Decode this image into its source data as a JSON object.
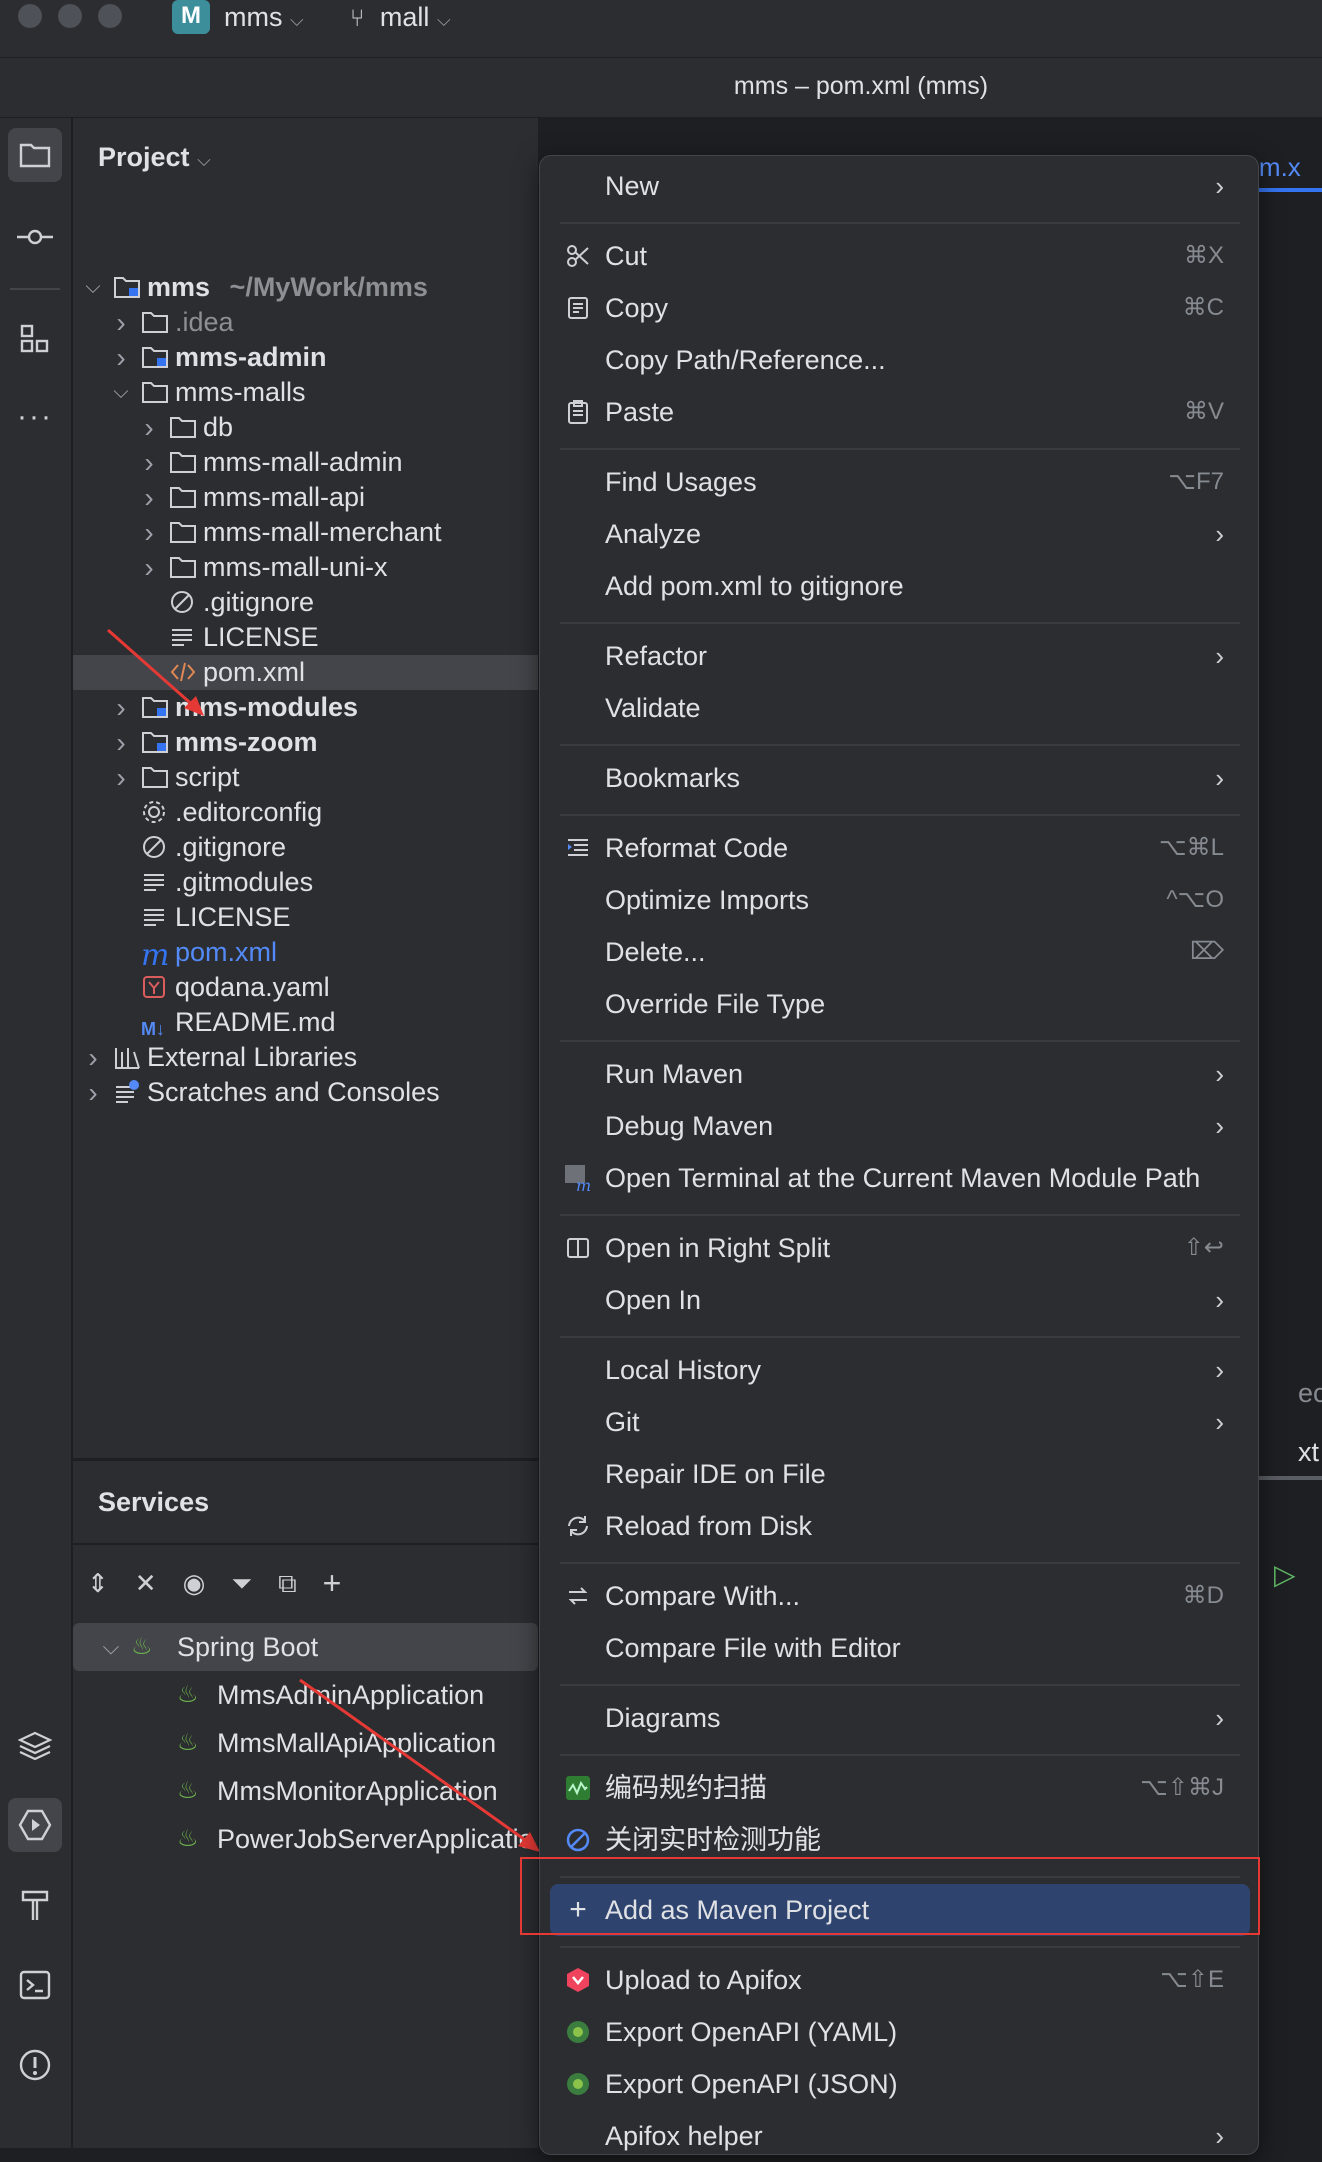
{
  "titlebar": {
    "project_badge": "M",
    "project_name": "mms",
    "branch_name": "mall",
    "window_title": "mms – pom.xml (mms)"
  },
  "editor": {
    "tab_label": "pom.x",
    "bg_text_1": "ect",
    "bg_text_2": "xt"
  },
  "project_panel": {
    "title": "Project",
    "tree": [
      {
        "label": "mms",
        "suffix": "~/MyWork/mms"
      },
      {
        "label": ".idea"
      },
      {
        "label": "mms-admin"
      },
      {
        "label": "mms-malls"
      },
      {
        "label": "db"
      },
      {
        "label": "mms-mall-admin"
      },
      {
        "label": "mms-mall-api"
      },
      {
        "label": "mms-mall-merchant"
      },
      {
        "label": "mms-mall-uni-x"
      },
      {
        "label": ".gitignore"
      },
      {
        "label": "LICENSE"
      },
      {
        "label": "pom.xml"
      },
      {
        "label": "mms-modules"
      },
      {
        "label": "mms-zoom"
      },
      {
        "label": "script"
      },
      {
        "label": ".editorconfig"
      },
      {
        "label": ".gitignore"
      },
      {
        "label": ".gitmodules"
      },
      {
        "label": "LICENSE"
      },
      {
        "label": "pom.xml"
      },
      {
        "label": "qodana.yaml"
      },
      {
        "label": "README.md"
      },
      {
        "label": "External Libraries"
      },
      {
        "label": "Scratches and Consoles"
      }
    ]
  },
  "services_panel": {
    "title": "Services",
    "group": "Spring Boot",
    "apps": [
      "MmsAdminApplication",
      "MmsMallApiApplication",
      "MmsMonitorApplication",
      "PowerJobServerApplicatio"
    ]
  },
  "context_menu": {
    "items": [
      {
        "label": "New",
        "shortcut": "",
        "submenu": true
      },
      {
        "label": "Cut",
        "shortcut": "⌘X"
      },
      {
        "label": "Copy",
        "shortcut": "⌘C"
      },
      {
        "label": "Copy Path/Reference...",
        "shortcut": ""
      },
      {
        "label": "Paste",
        "shortcut": "⌘V"
      },
      {
        "label": "Find Usages",
        "shortcut": "⌥F7"
      },
      {
        "label": "Analyze",
        "submenu": true
      },
      {
        "label": "Add pom.xml to gitignore"
      },
      {
        "label": "Refactor",
        "submenu": true
      },
      {
        "label": "Validate"
      },
      {
        "label": "Bookmarks",
        "submenu": true
      },
      {
        "label": "Reformat Code",
        "shortcut": "⌥⌘L"
      },
      {
        "label": "Optimize Imports",
        "shortcut": "^⌥O"
      },
      {
        "label": "Delete...",
        "shortcut": "⌦"
      },
      {
        "label": "Override File Type"
      },
      {
        "label": "Run Maven",
        "submenu": true
      },
      {
        "label": "Debug Maven",
        "submenu": true
      },
      {
        "label": "Open Terminal at the Current Maven Module Path"
      },
      {
        "label": "Open in Right Split",
        "shortcut": "⇧↩"
      },
      {
        "label": "Open In",
        "submenu": true
      },
      {
        "label": "Local History",
        "submenu": true
      },
      {
        "label": "Git",
        "submenu": true
      },
      {
        "label": "Repair IDE on File"
      },
      {
        "label": "Reload from Disk"
      },
      {
        "label": "Compare With...",
        "shortcut": "⌘D"
      },
      {
        "label": "Compare File with Editor"
      },
      {
        "label": "Diagrams",
        "submenu": true
      },
      {
        "label": "编码规约扫描",
        "shortcut": "⌥⇧⌘J"
      },
      {
        "label": "关闭实时检测功能"
      },
      {
        "label": "Add as Maven Project"
      },
      {
        "label": "Upload to Apifox",
        "shortcut": "⌥⇧E"
      },
      {
        "label": "Export OpenAPI (YAML)"
      },
      {
        "label": "Export OpenAPI (JSON)"
      },
      {
        "label": "Apifox helper",
        "submenu": true
      }
    ]
  },
  "colors": {
    "accent": "#3574f0",
    "highlight": "#2e436e",
    "annotation_red": "#e53935"
  }
}
